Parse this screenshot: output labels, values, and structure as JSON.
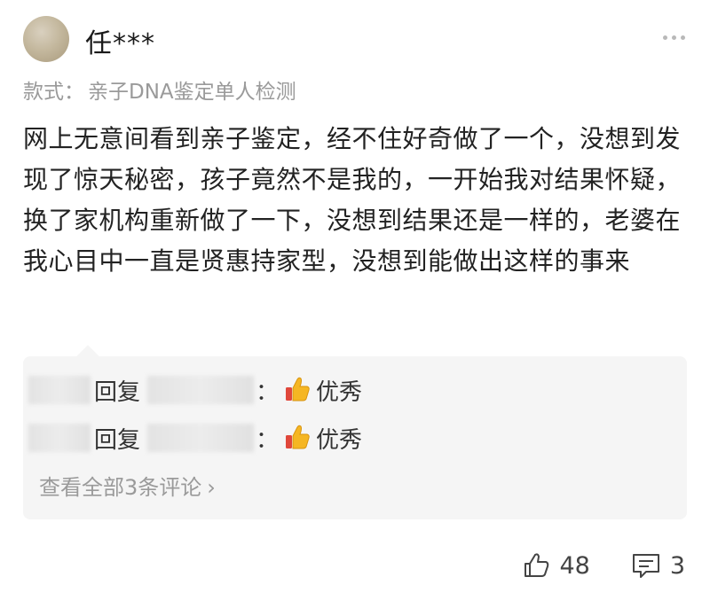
{
  "review": {
    "username": "任***",
    "variant_label": "款式：",
    "variant_value": "亲子DNA鉴定单人检测",
    "content": "网上无意间看到亲子鉴定，经不住好奇做了一个，没想到发现了惊天秘密，孩子竟然不是我的，一开始我对结果怀疑，换了家机构重新做了一下，没想到结果还是一样的，老婆在我心目中一直是贤惠持家型，没想到能做出这样的事来"
  },
  "replies": [
    {
      "reply_word": "回复",
      "colon": "：",
      "text": "优秀",
      "emoji": "thumbs-up-icon"
    },
    {
      "reply_word": "回复",
      "colon": "：",
      "text": "优秀",
      "emoji": "thumbs-up-icon"
    }
  ],
  "view_all": {
    "label": "查看全部3条评论",
    "chevron": "›"
  },
  "footer": {
    "like_count": "48",
    "comment_count": "3"
  },
  "colors": {
    "accent_reply_bg": "#f5f5f5",
    "muted_text": "#9a9a9a",
    "thumb_emoji": "#f5b623"
  }
}
